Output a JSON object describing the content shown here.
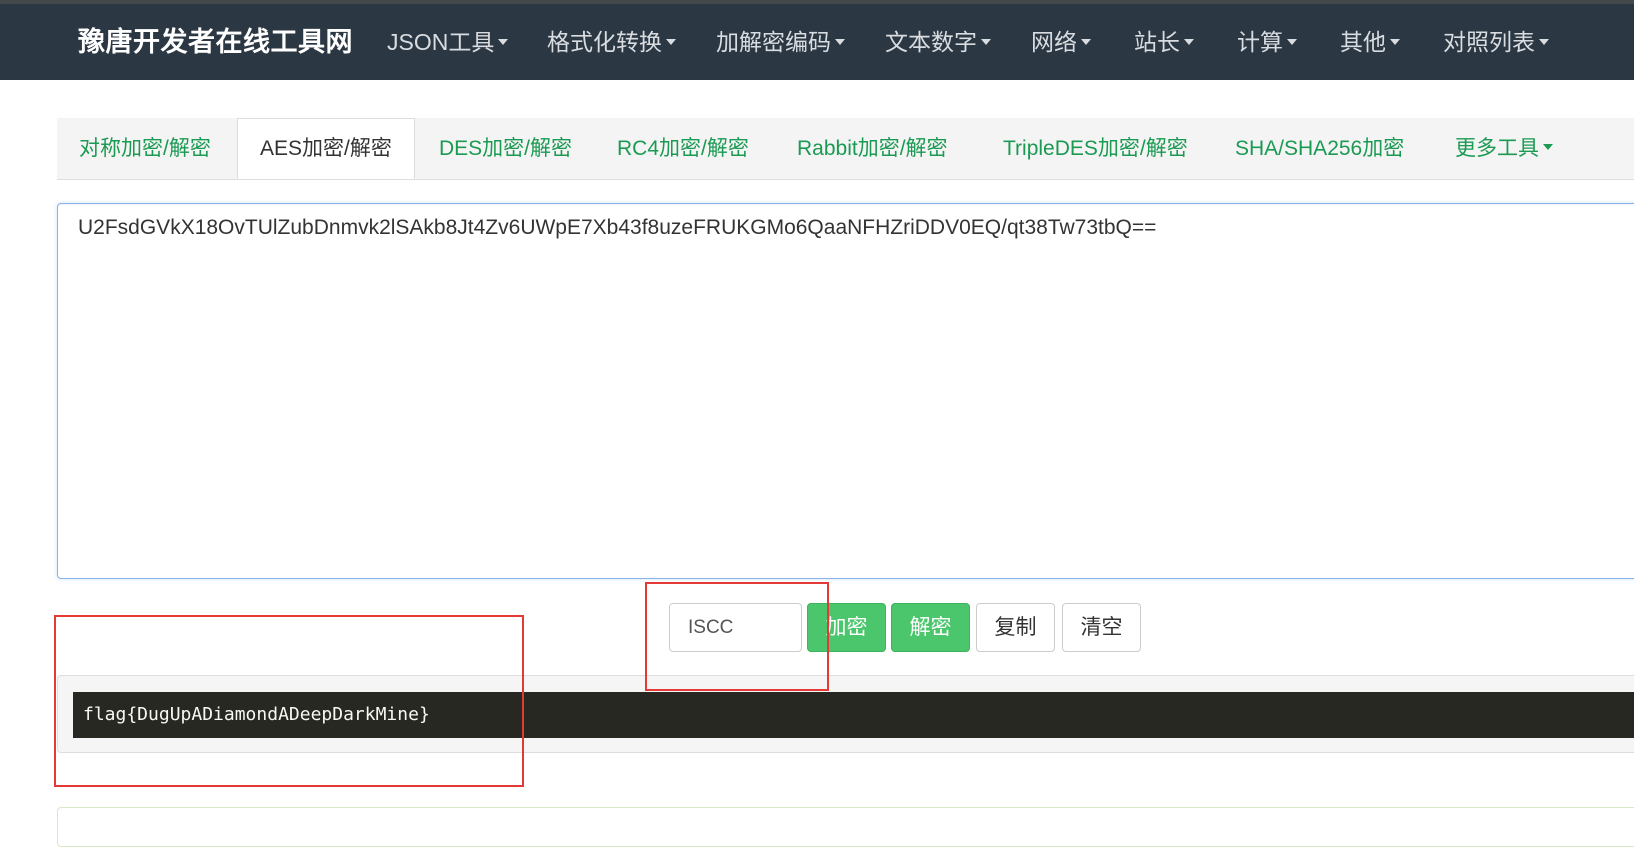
{
  "navbar": {
    "brand": "豫唐开发者在线工具网",
    "items": [
      "JSON工具",
      "格式化转换",
      "加解密编码",
      "文本数字",
      "网络",
      "站长",
      "计算",
      "其他",
      "对照列表"
    ]
  },
  "tabs": [
    "对称加密/解密",
    "AES加密/解密",
    "DES加密/解密",
    "RC4加密/解密",
    "Rabbit加密/解密",
    "TripleDES加密/解密",
    "SHA/SHA256加密",
    "更多工具"
  ],
  "active_tab": "AES加密/解密",
  "editor": {
    "text": "U2FsdGVkX18OvTUlZubDnmvk2lSAkb8Jt4Zv6UWpE7Xb43f8uzeFRUKGMo6QaaNFHZriDDV0EQ/qt38Tw73tbQ=="
  },
  "key_input": {
    "value": "ISCC"
  },
  "buttons": {
    "encrypt": "加密",
    "decrypt": "解密",
    "copy": "复制",
    "clear": "清空"
  },
  "result": {
    "text": "flag{DugUpADiamondADeepDarkMine}"
  },
  "colors": {
    "navbar_bg": "#2b3743",
    "tab_link": "#1a9a52",
    "button_green": "#4cc66d",
    "result_bg": "#272822",
    "annotation_red": "#e53935"
  }
}
